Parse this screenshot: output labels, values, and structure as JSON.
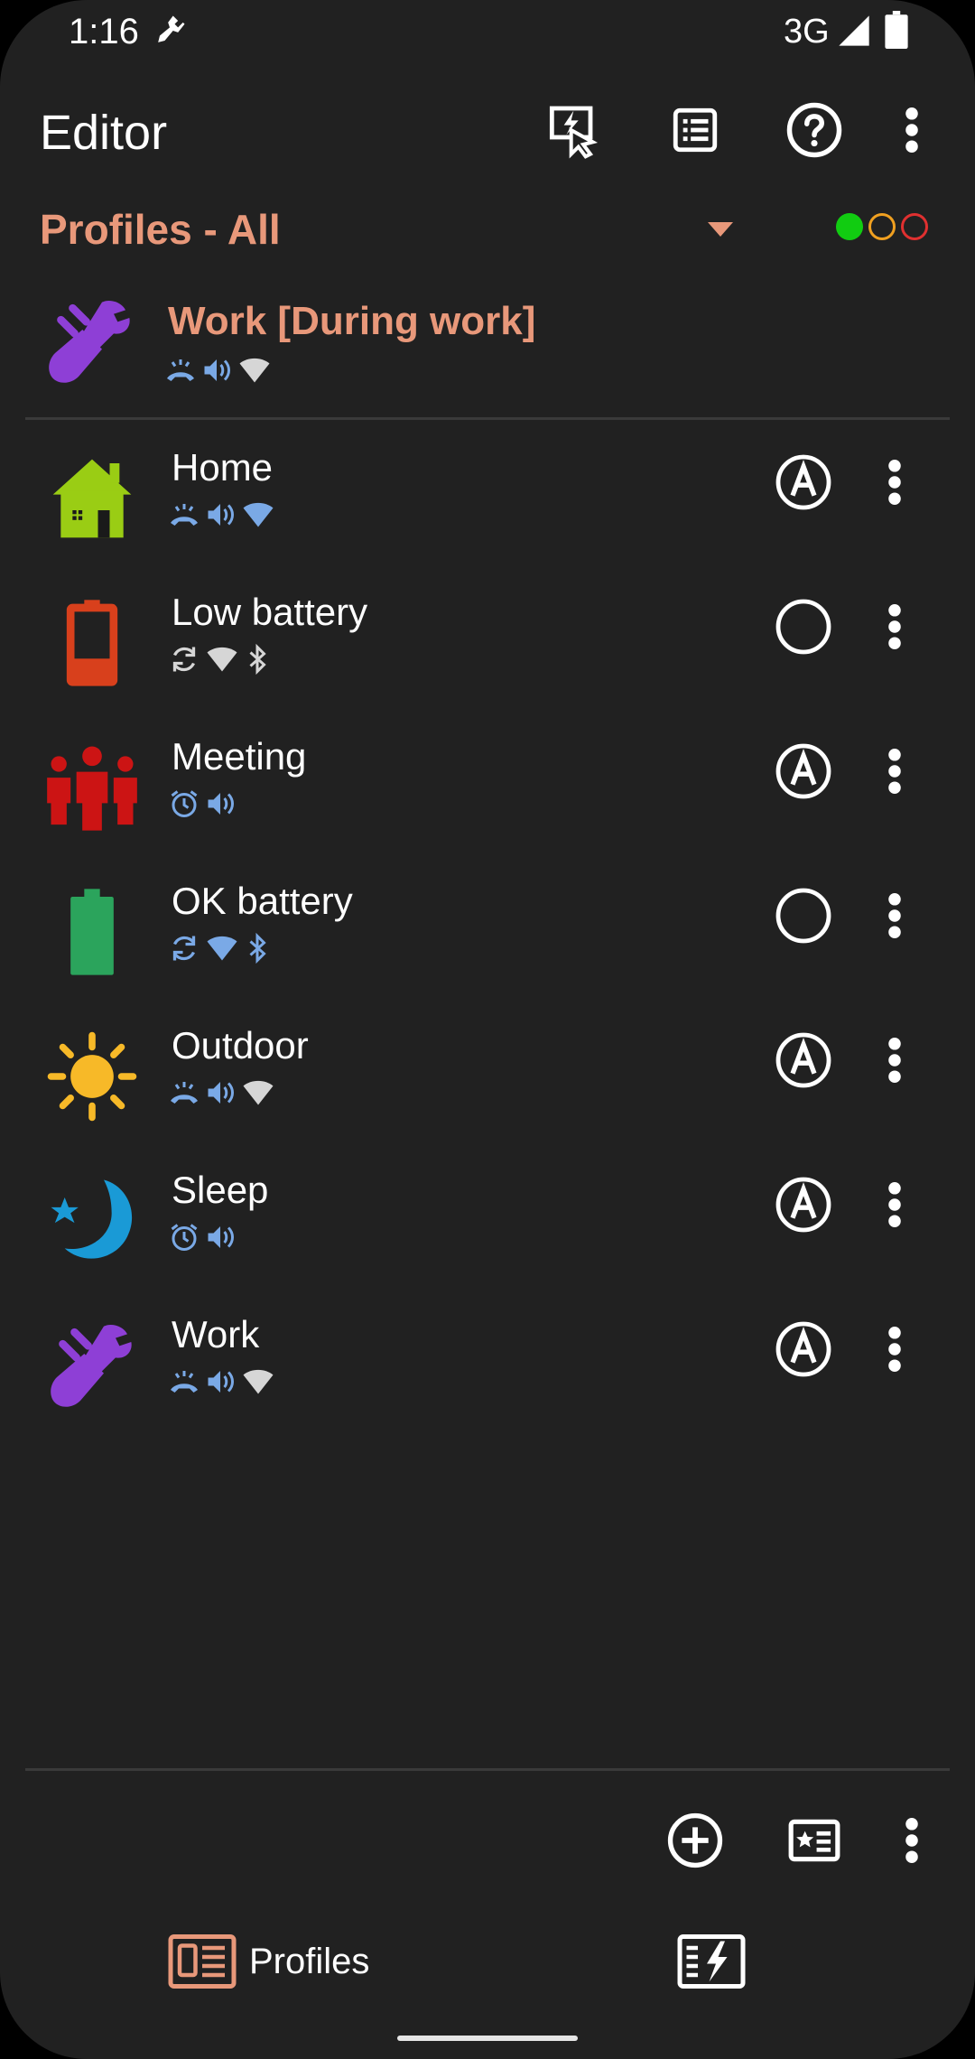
{
  "status_bar": {
    "time": "1:16",
    "network": "3G",
    "icons": [
      "plug-icon",
      "signal-icon",
      "battery-icon"
    ]
  },
  "toolbar": {
    "title": "Editor",
    "actions": [
      "activator-icon",
      "list-icon",
      "help-icon",
      "more-vert-icon"
    ]
  },
  "filter": {
    "label": "Profiles - All",
    "lights": [
      "#11cc11",
      "#f0a020",
      "#e03030"
    ]
  },
  "active_profile": {
    "name": "Work [During work]",
    "icon": "work-plug-icon",
    "indicators": [
      "vibrate-ring-icon",
      "volume-icon",
      "wifi-icon"
    ]
  },
  "profiles": [
    {
      "name": "Home",
      "icon": "house-icon",
      "indicators": [
        "vibrate-ring-icon",
        "volume-icon",
        "wifi-on-icon"
      ],
      "activation": "A"
    },
    {
      "name": "Low battery",
      "icon": "battery-low-icon",
      "indicators": [
        "sync-icon",
        "wifi-off-icon",
        "bluetooth-icon"
      ],
      "activation": ""
    },
    {
      "name": "Meeting",
      "icon": "people-icon",
      "indicators": [
        "alarm-icon",
        "volume-icon"
      ],
      "activation": "A"
    },
    {
      "name": "OK battery",
      "icon": "battery-full-icon",
      "indicators": [
        "sync-icon",
        "wifi-on-icon",
        "bluetooth-icon"
      ],
      "activation": ""
    },
    {
      "name": "Outdoor",
      "icon": "sun-icon",
      "indicators": [
        "vibrate-ring-icon",
        "volume-icon",
        "wifi-off-icon"
      ],
      "activation": "A"
    },
    {
      "name": "Sleep",
      "icon": "moon-icon",
      "indicators": [
        "alarm-icon",
        "volume-icon"
      ],
      "activation": "A"
    },
    {
      "name": "Work",
      "icon": "work-plug-icon",
      "indicators": [
        "vibrate-ring-icon",
        "volume-icon",
        "wifi-off-icon"
      ],
      "activation": "A"
    }
  ],
  "bottom_toolbar": {
    "actions": [
      "add-circle-icon",
      "profile-card-icon",
      "more-vert-icon"
    ]
  },
  "bottom_nav": {
    "profiles_label": "Profiles",
    "items": [
      "profiles-nav-icon",
      "events-nav-icon"
    ]
  },
  "colors": {
    "background": "#212121",
    "accent": "#e8987a",
    "indicator_blue": "#7aa9e6",
    "indicator_grey": "#bdbdbd"
  }
}
